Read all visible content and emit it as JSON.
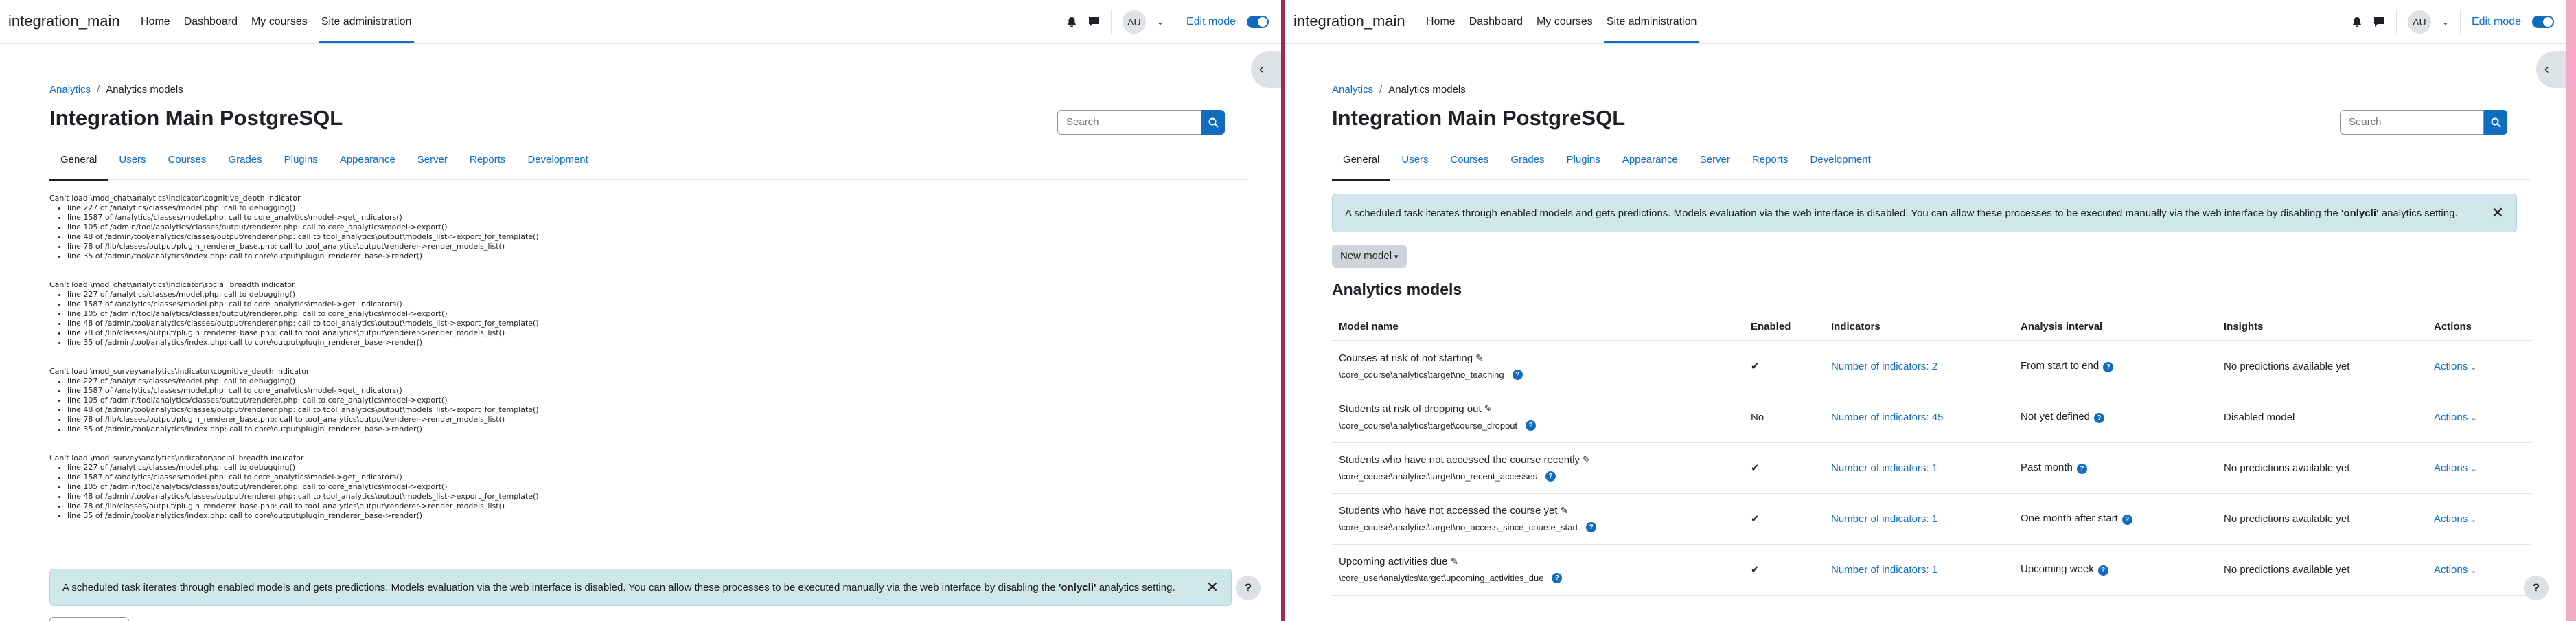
{
  "colors": {
    "primary": "#0f6cbf",
    "alert_bg": "#cfe6ea",
    "divider": "#9c2a55"
  },
  "nav": {
    "brand": "integration_main",
    "links": [
      "Home",
      "Dashboard",
      "My courses",
      "Site administration"
    ],
    "avatar": "AU",
    "edit_mode": "Edit mode"
  },
  "breadcrumb": {
    "parent": "Analytics",
    "current": "Analytics models"
  },
  "page": {
    "title": "Integration Main PostgreSQL",
    "search_placeholder": "Search"
  },
  "tabs": [
    "General",
    "Users",
    "Courses",
    "Grades",
    "Plugins",
    "Appearance",
    "Server",
    "Reports",
    "Development"
  ],
  "debug": [
    {
      "heading": "Can't load \\mod_chat\\analytics\\indicator\\cognitive_depth indicator",
      "lines": [
        "line 227 of /analytics/classes/model.php: call to debugging()",
        "line 1587 of /analytics/classes/model.php: call to core_analytics\\model->get_indicators()",
        "line 105 of /admin/tool/analytics/classes/output/renderer.php: call to core_analytics\\model->export()",
        "line 48 of /admin/tool/analytics/classes/output/renderer.php: call to tool_analytics\\output\\models_list->export_for_template()",
        "line 78 of /lib/classes/output/plugin_renderer_base.php: call to tool_analytics\\output\\renderer->render_models_list()",
        "line 35 of /admin/tool/analytics/index.php: call to core\\output\\plugin_renderer_base->render()"
      ]
    },
    {
      "heading": "Can't load \\mod_chat\\analytics\\indicator\\social_breadth indicator",
      "lines": [
        "line 227 of /analytics/classes/model.php: call to debugging()",
        "line 1587 of /analytics/classes/model.php: call to core_analytics\\model->get_indicators()",
        "line 105 of /admin/tool/analytics/classes/output/renderer.php: call to core_analytics\\model->export()",
        "line 48 of /admin/tool/analytics/classes/output/renderer.php: call to tool_analytics\\output\\models_list->export_for_template()",
        "line 78 of /lib/classes/output/plugin_renderer_base.php: call to tool_analytics\\output\\renderer->render_models_list()",
        "line 35 of /admin/tool/analytics/index.php: call to core\\output\\plugin_renderer_base->render()"
      ]
    },
    {
      "heading": "Can't load \\mod_survey\\analytics\\indicator\\cognitive_depth indicator",
      "lines": [
        "line 227 of /analytics/classes/model.php: call to debugging()",
        "line 1587 of /analytics/classes/model.php: call to core_analytics\\model->get_indicators()",
        "line 105 of /admin/tool/analytics/classes/output/renderer.php: call to core_analytics\\model->export()",
        "line 48 of /admin/tool/analytics/classes/output/renderer.php: call to tool_analytics\\output\\models_list->export_for_template()",
        "line 78 of /lib/classes/output/plugin_renderer_base.php: call to tool_analytics\\output\\renderer->render_models_list()",
        "line 35 of /admin/tool/analytics/index.php: call to core\\output\\plugin_renderer_base->render()"
      ]
    },
    {
      "heading": "Can't load \\mod_survey\\analytics\\indicator\\social_breadth indicator",
      "lines": [
        "line 227 of /analytics/classes/model.php: call to debugging()",
        "line 1587 of /analytics/classes/model.php: call to core_analytics\\model->get_indicators()",
        "line 105 of /admin/tool/analytics/classes/output/renderer.php: call to core_analytics\\model->export()",
        "line 48 of /admin/tool/analytics/classes/output/renderer.php: call to tool_analytics\\output\\models_list->export_for_template()",
        "line 78 of /lib/classes/output/plugin_renderer_base.php: call to tool_analytics\\output\\renderer->render_models_list()",
        "line 35 of /admin/tool/analytics/index.php: call to core\\output\\plugin_renderer_base->render()"
      ]
    }
  ],
  "alert": {
    "before": "A scheduled task iterates through enabled models and gets predictions. Models evaluation via the web interface is disabled. You can allow these processes to be executed manually via the web interface by disabling the ",
    "bold": "'onlycli'",
    "after": " analytics setting."
  },
  "new_model": "New model",
  "models_heading": "Analytics models",
  "table": {
    "headers": [
      "Model name",
      "Enabled",
      "Indicators",
      "Analysis interval",
      "Insights",
      "Actions"
    ],
    "rows": [
      {
        "name": "Courses at risk of not starting",
        "target": "\\core_course\\analytics\\target\\no_teaching",
        "enabled": "✔",
        "indicators": "Number of indicators: 2",
        "interval": "From start to end",
        "insights": "No predictions available yet",
        "actions": "Actions"
      },
      {
        "name": "Students at risk of dropping out",
        "target": "\\core_course\\analytics\\target\\course_dropout",
        "enabled": "No",
        "indicators": "Number of indicators: 45",
        "interval": "Not yet defined",
        "insights": "Disabled model",
        "actions": "Actions"
      },
      {
        "name": "Students who have not accessed the course recently",
        "target": "\\core_course\\analytics\\target\\no_recent_accesses",
        "enabled": "✔",
        "indicators": "Number of indicators: 1",
        "interval": "Past month",
        "insights": "No predictions available yet",
        "actions": "Actions"
      },
      {
        "name": "Students who have not accessed the course yet",
        "target": "\\core_course\\analytics\\target\\no_access_since_course_start",
        "enabled": "✔",
        "indicators": "Number of indicators: 1",
        "interval": "One month after start",
        "insights": "No predictions available yet",
        "actions": "Actions"
      },
      {
        "name": "Upcoming activities due",
        "target": "\\core_user\\analytics\\target\\upcoming_activities_due",
        "enabled": "✔",
        "indicators": "Number of indicators: 1",
        "interval": "Upcoming week",
        "insights": "No predictions available yet",
        "actions": "Actions"
      }
    ]
  }
}
